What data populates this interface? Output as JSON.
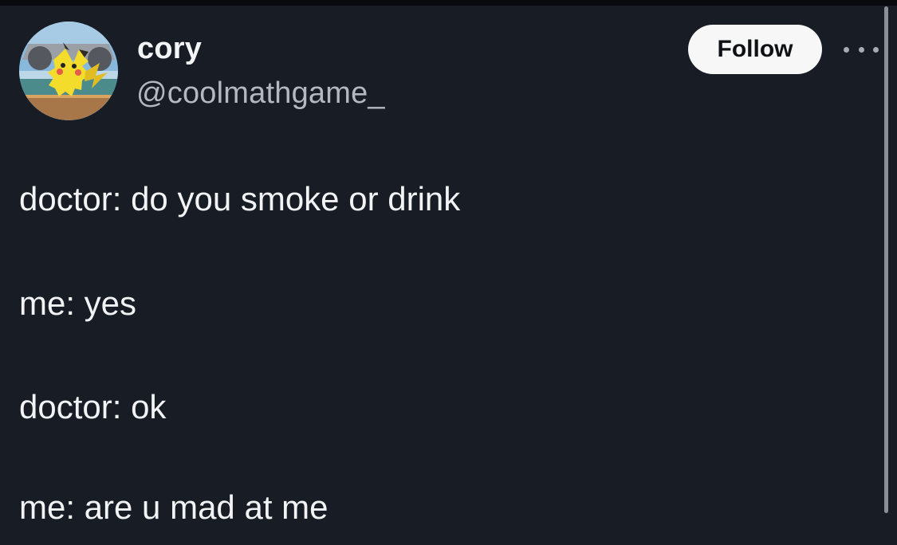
{
  "author": {
    "name": "cory",
    "handle": "@coolmathgame_"
  },
  "actions": {
    "follow_label": "Follow"
  },
  "tweet": {
    "lines": [
      "doctor: do you smoke or drink",
      "me: yes",
      "doctor: ok",
      "me: are u mad at me"
    ]
  },
  "icons": {
    "more": "more-options-icon",
    "avatar": "pikachu-avatar"
  },
  "colors": {
    "background": "#171c25",
    "text": "#f2f3f5",
    "handle_text": "#b4b9c1",
    "follow_button": "#f7f7f8"
  }
}
